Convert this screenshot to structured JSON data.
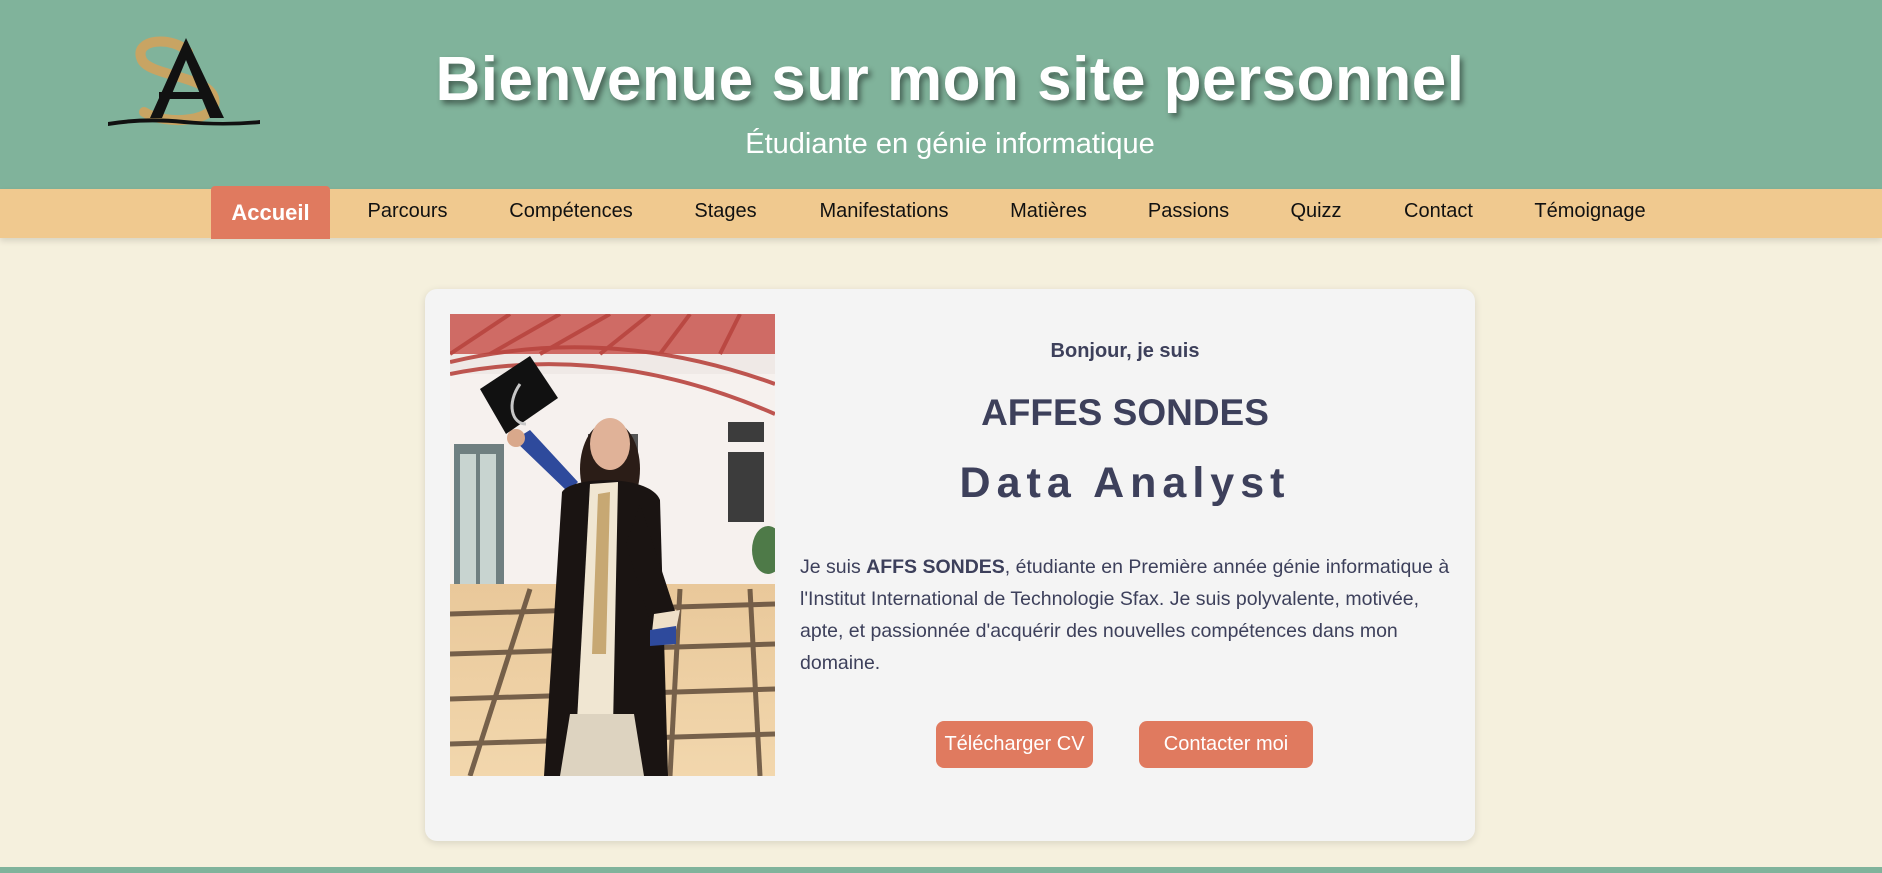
{
  "header": {
    "logo_alt": "AS logo",
    "title": "Bienvenue sur mon site personnel",
    "subtitle": "Étudiante en génie informatique"
  },
  "nav": {
    "items": [
      {
        "label": "Accueil",
        "active": true
      },
      {
        "label": "Parcours"
      },
      {
        "label": "Compétences"
      },
      {
        "label": "Stages"
      },
      {
        "label": "Manifestations"
      },
      {
        "label": "Matières"
      },
      {
        "label": "Passions"
      },
      {
        "label": "Quizz"
      },
      {
        "label": "Contact"
      },
      {
        "label": "Témoignage"
      }
    ]
  },
  "profile": {
    "greeting": "Bonjour, je suis",
    "name": "AFFES SONDES",
    "role": "Data Analyst",
    "bio_prefix": "Je suis ",
    "bio_name": "AFFS SONDES",
    "bio_rest": ", étudiante en Première année génie informatique à l'Institut International de Technologie Sfax. Je suis polyvalente, motivée, apte, et passionnée d'acquérir des nouvelles compétences dans mon domaine.",
    "photo_icon": "graduate-photo"
  },
  "buttons": {
    "download_cv": "Télécharger CV",
    "contact_me": "Contacter moi"
  },
  "colors": {
    "header_bg": "#80b39b",
    "nav_bg": "#f0c98f",
    "accent": "#e07a5f",
    "text_dark": "#3d405b",
    "page_bg": "#f5f0dd",
    "card_bg": "#f4f4f4"
  }
}
